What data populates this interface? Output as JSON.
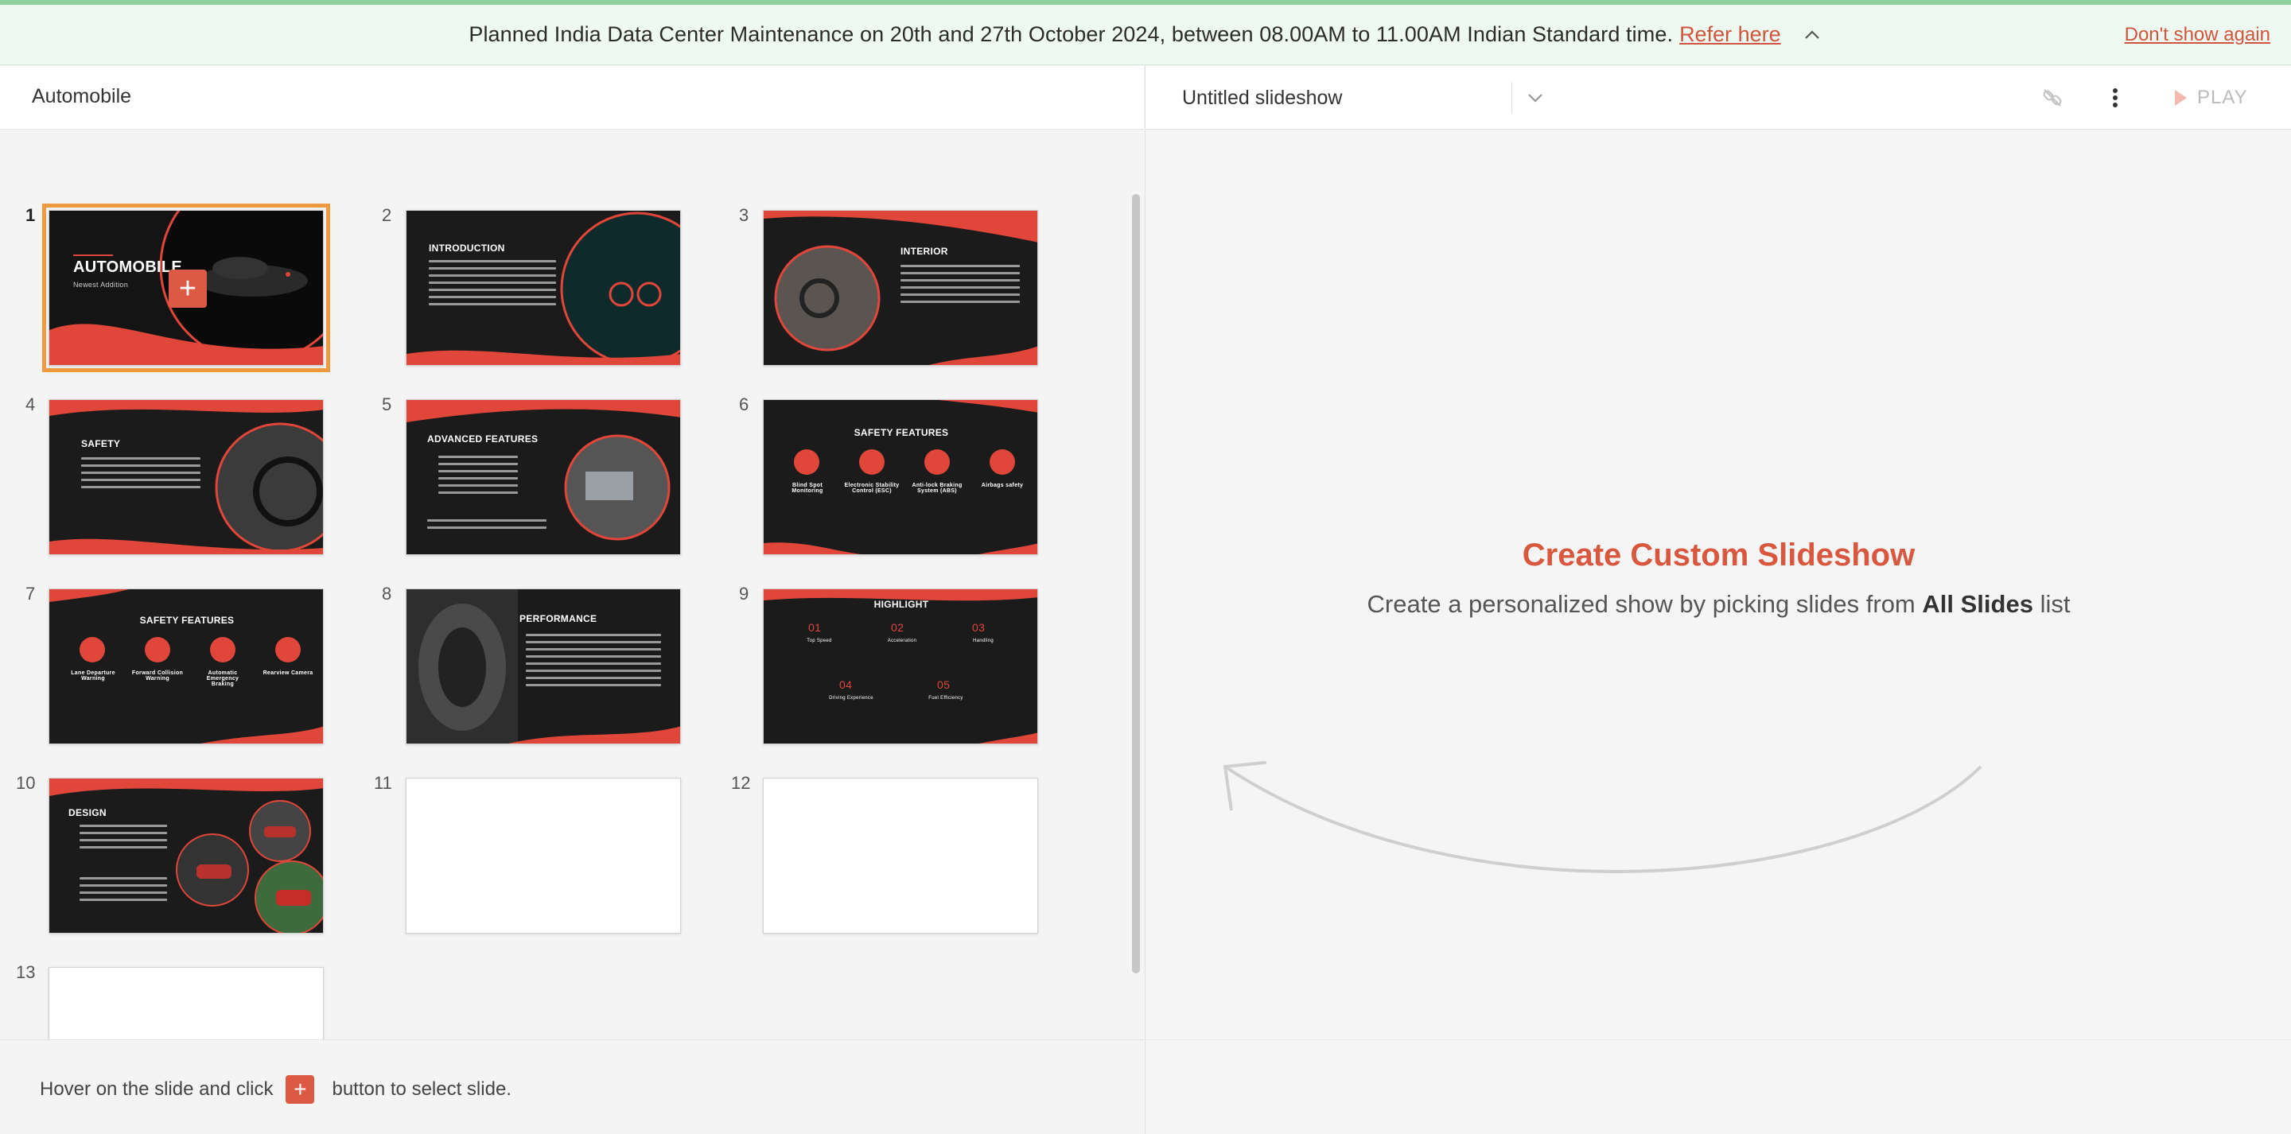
{
  "banner": {
    "text": "Planned India Data Center Maintenance on 20th and 27th October 2024, between 08.00AM to 11.00AM Indian Standard time.",
    "link": "Refer here",
    "dismiss": "Don't show again",
    "icon": "chevron-up-icon"
  },
  "left_header": {
    "title": "Automobile"
  },
  "right_header": {
    "slideshow_name": "Untitled slideshow",
    "play_label": "PLAY",
    "icons": [
      "chevron-down-icon",
      "link-icon",
      "more-vertical-icon",
      "play-icon"
    ]
  },
  "slides": [
    {
      "num": "1",
      "title": "AUTOMOBILE",
      "subtitle": "Newest Addition",
      "selected": true
    },
    {
      "num": "2",
      "title": "INTRODUCTION"
    },
    {
      "num": "3",
      "title": "INTERIOR"
    },
    {
      "num": "4",
      "title": "SAFETY"
    },
    {
      "num": "5",
      "title": "ADVANCED FEATURES"
    },
    {
      "num": "6",
      "title": "SAFETY FEATURES",
      "items": [
        "Blind Spot Monitoring",
        "Electronic Stability Control (ESC)",
        "Anti-lock Braking System (ABS)",
        "Airbags safety"
      ]
    },
    {
      "num": "7",
      "title": "SAFETY FEATURES",
      "items": [
        "Lane Departure Warning",
        "Forward Collision Warning",
        "Automatic Emergency Braking",
        "Rearview Camera"
      ]
    },
    {
      "num": "8",
      "title": "PERFORMANCE"
    },
    {
      "num": "9",
      "title": "HIGHLIGHT",
      "items": [
        "01",
        "02",
        "03",
        "04",
        "05"
      ],
      "captions": [
        "Top Speed",
        "Acceleration",
        "Handling",
        "Driving Experience",
        "Fuel Efficiency"
      ]
    },
    {
      "num": "10",
      "title": "DESIGN"
    },
    {
      "num": "11",
      "title": ""
    },
    {
      "num": "12",
      "title": ""
    },
    {
      "num": "13",
      "title": ""
    }
  ],
  "bottom_hint": {
    "before": "Hover on the slide and click",
    "after": "button to select slide.",
    "button": "+"
  },
  "main": {
    "title": "Create Custom Slideshow",
    "subtitle_before": "Create a personalized show by picking slides from",
    "subtitle_bold": "All Slides",
    "subtitle_after": "list"
  },
  "colors": {
    "accent": "#d9573f",
    "selection": "#ef9a3e",
    "slide_red": "#e0463a",
    "slide_dark": "#1b1b1b"
  }
}
